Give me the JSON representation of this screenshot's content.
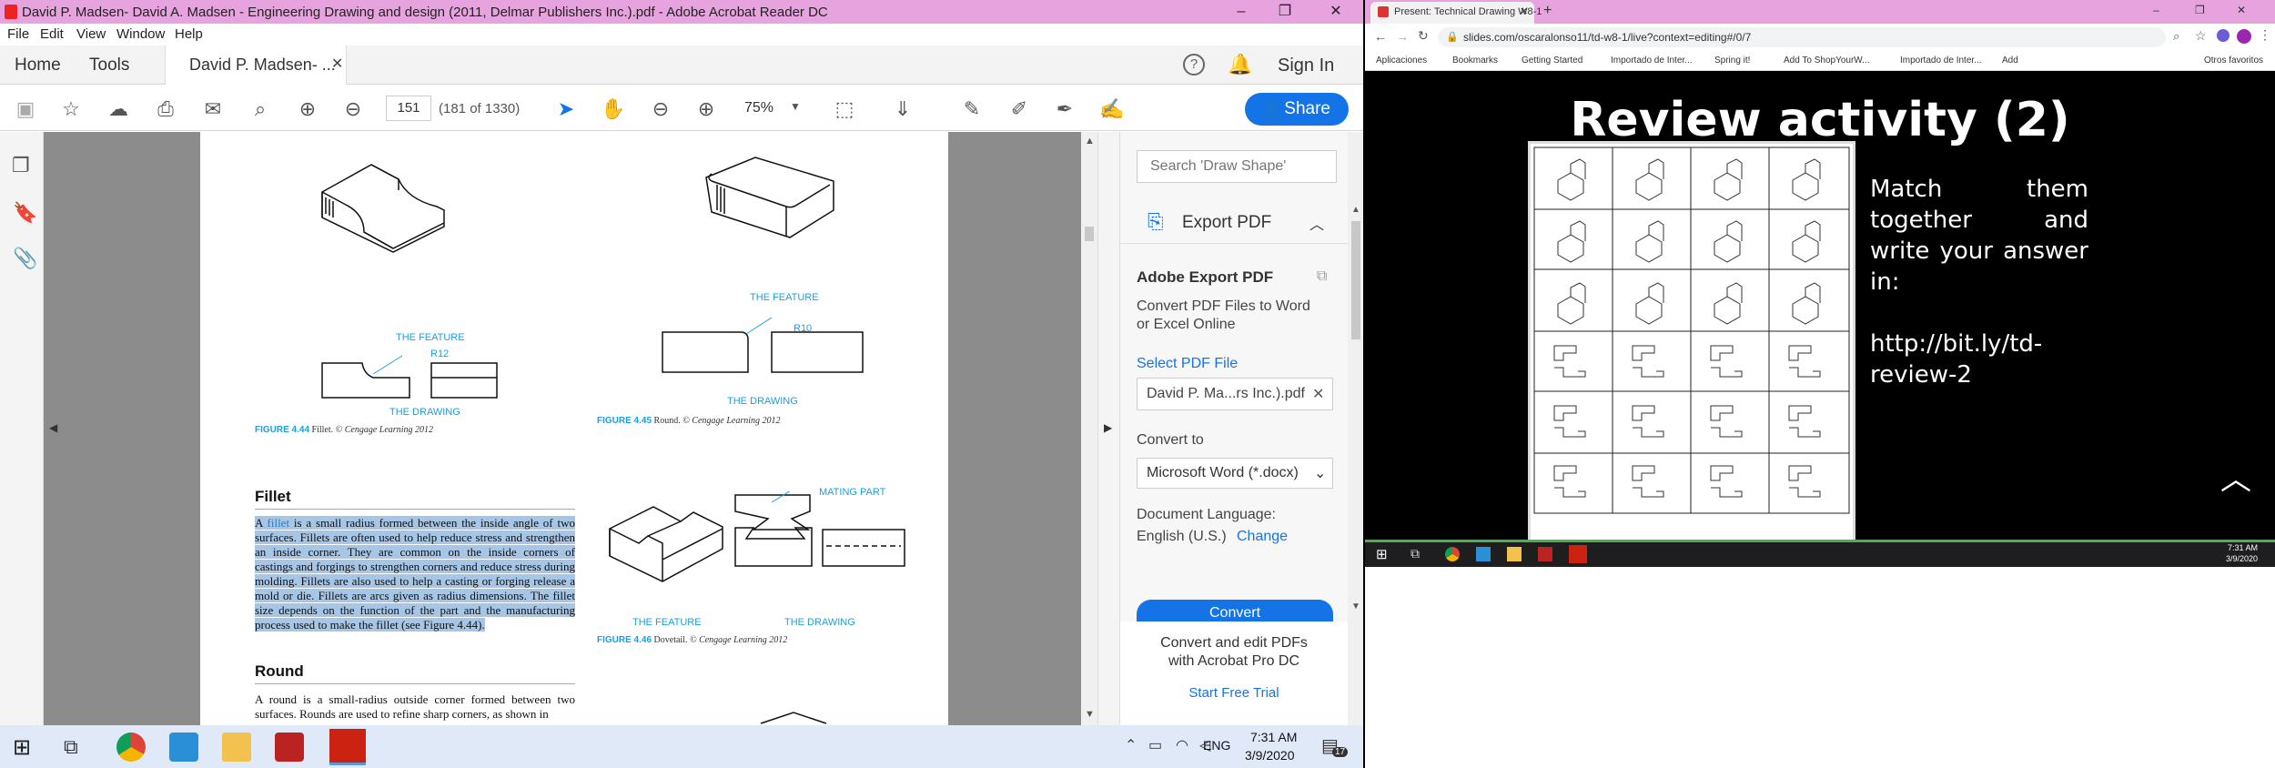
{
  "acrobat": {
    "title": "David P. Madsen- David A. Madsen - Engineering Drawing and design (2011, Delmar Publishers Inc.).pdf - Adobe Acrobat Reader DC",
    "menu": [
      "File",
      "Edit",
      "View",
      "Window",
      "Help"
    ],
    "tabs": {
      "home": "Home",
      "tools": "Tools",
      "doc": "David P. Madsen- ..."
    },
    "sign_in": "Sign In",
    "page_num": "151",
    "page_count": "(181 of 1330)",
    "zoom": "75%",
    "share": "Share"
  },
  "pdf": {
    "fig44_feature": "THE FEATURE",
    "fig44_r": "R12",
    "fig44_drawing": "THE DRAWING",
    "fig44_caption_num": "FIGURE 4.44",
    "fig44_caption": "Fillet.",
    "fig44_copy": "© Cengage Learning 2012",
    "fig45_feature": "THE FEATURE",
    "fig45_r": "R10",
    "fig45_drawing": "THE DRAWING",
    "fig45_caption_num": "FIGURE 4.45",
    "fig45_caption": "Round.",
    "fig45_copy": "© Cengage Learning 2012",
    "fig46_mating": "MATING PART",
    "fig46_feature": "THE FEATURE",
    "fig46_drawing": "THE DRAWING",
    "fig46_caption_num": "FIGURE 4.46",
    "fig46_caption": "Dovetail.",
    "fig46_copy": "© Cengage Learning 2012",
    "fillet_heading": "Fillet",
    "fillet_a": "A ",
    "fillet_word": "fillet",
    "fillet_body": " is a small radius formed between the inside angle of two surfaces. Fillets are often used to help reduce stress and strengthen an inside corner. They are common on the inside corners of castings and forgings to strengthen corners and reduce stress during molding. Fillets are also used to help a casting or forging release a mold or die. Fillets are arcs given as radius dimensions. The fillet size depends on the function of the part and the manufacturing process used to make the fillet (see Figure 4.44).",
    "round_heading": "Round",
    "round_body": "A round is a small-radius outside corner formed between two surfaces. Rounds are used to refine sharp corners, as shown in"
  },
  "right_panel": {
    "search_placeholder": "Search 'Draw Shape'",
    "export_title": "Export PDF",
    "adobe_export": "Adobe Export PDF",
    "convert_desc": "Convert PDF Files to Word or Excel Online",
    "select_pdf": "Select PDF File",
    "file_name": "David P. Ma...rs Inc.).pdf",
    "convert_to": "Convert to",
    "format": "Microsoft Word (*.docx)",
    "doc_lang": "Document Language:",
    "lang": "English (U.S.)",
    "change": "Change",
    "convert_btn": "Convert",
    "promo": "Convert and edit PDFs with Acrobat Pro DC",
    "trial": "Start Free Trial"
  },
  "taskbar": {
    "time": "7:31 AM",
    "date": "3/9/2020",
    "lang": "ENG",
    "notif": "17"
  },
  "chrome": {
    "tab_title": "Present: Technical Drawing W8-1",
    "url": "slides.com/oscaralonso11/td-w8-1/live?context=editing#/0/7",
    "bookmarks": [
      "Aplicaciones",
      "Bookmarks",
      "Getting Started",
      "Importado de Inter...",
      "Spring it!",
      "Add To ShopYourW...",
      "Importado de Inter...",
      "Add",
      "Otros favoritos"
    ],
    "slide_title": "Review activity (2)",
    "slide_text_1": "Match them together and write your answer in:",
    "slide_text_2": "http://bit.ly/td-review-2",
    "inner_time": "7:31 AM",
    "inner_date": "3/9/2020"
  },
  "colors": {
    "accent": "#1473e6",
    "title_bar": "#e7a3de",
    "caption_blue": "#1aa0e0",
    "highlight": "#a7c6e6"
  }
}
